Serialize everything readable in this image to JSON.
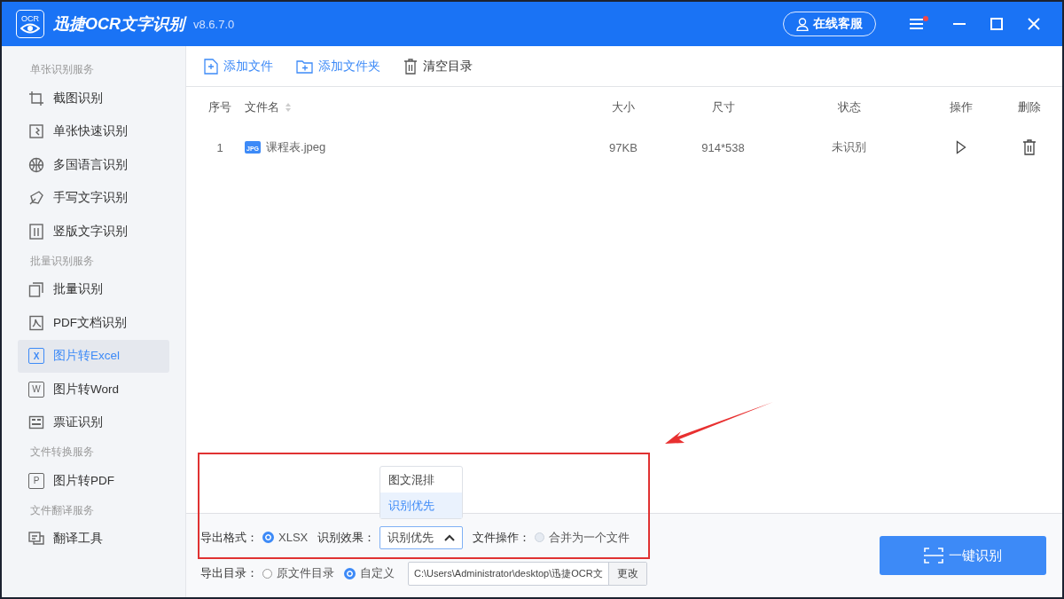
{
  "window": {
    "logo_text": "OCR",
    "title": "迅捷OCR文字识别",
    "version": "v8.6.7.0",
    "support_button": "在线客服",
    "menu_notification": true
  },
  "sidebar": {
    "groups": [
      {
        "heading": "单张识别服务",
        "items": [
          {
            "label": "截图识别",
            "selected": false
          },
          {
            "label": "单张快速识别",
            "selected": false
          },
          {
            "label": "多国语言识别",
            "selected": false
          },
          {
            "label": "手写文字识别",
            "selected": false
          },
          {
            "label": "竖版文字识别",
            "selected": false
          }
        ]
      },
      {
        "heading": "批量识别服务",
        "items": [
          {
            "label": "批量识别",
            "selected": false
          },
          {
            "label": "PDF文档识别",
            "selected": false
          },
          {
            "label": "图片转Excel",
            "selected": true,
            "icon_text": "X"
          },
          {
            "label": "图片转Word",
            "selected": false,
            "icon_text": "W"
          },
          {
            "label": "票证识别",
            "selected": false
          }
        ]
      },
      {
        "heading": "文件转换服务",
        "items": [
          {
            "label": "图片转PDF",
            "selected": false,
            "icon_text": "P"
          }
        ]
      },
      {
        "heading": "文件翻译服务",
        "items": [
          {
            "label": "翻译工具",
            "selected": false
          }
        ]
      }
    ]
  },
  "toolbar": [
    "添加文件",
    "添加文件夹",
    "清空目录"
  ],
  "table": {
    "columns": [
      "序号",
      "文件名",
      "大小",
      "尺寸",
      "状态",
      "操作",
      "删除"
    ],
    "rows": [
      {
        "index": "1",
        "file_badge": "JPG",
        "file_name": "课程表.jpeg",
        "size": "97KB",
        "dimensions": "914*538",
        "status": "未识别"
      }
    ]
  },
  "options": {
    "export_format": {
      "label": "导出格式：",
      "choices": [
        {
          "label": "XLSX",
          "selected": true
        }
      ]
    },
    "recognition_effect": {
      "label": "识别效果：",
      "value": "识别优先",
      "expanded": true,
      "options": [
        {
          "label": "图文混排",
          "selected": false
        },
        {
          "label": "识别优先",
          "selected": true
        }
      ]
    },
    "file_operation": {
      "label": "文件操作：",
      "choices": [
        {
          "label": "合并为一个文件",
          "selected": false
        }
      ]
    },
    "export_directory": {
      "label": "导出目录：",
      "choices": [
        {
          "label": "原文件目录",
          "selected": false
        },
        {
          "label": "自定义",
          "selected": true
        }
      ],
      "path": "C:\\Users\\Administrator\\desktop\\迅捷OCR文",
      "change_button": "更改"
    }
  },
  "recognize_button": "一键识别"
}
